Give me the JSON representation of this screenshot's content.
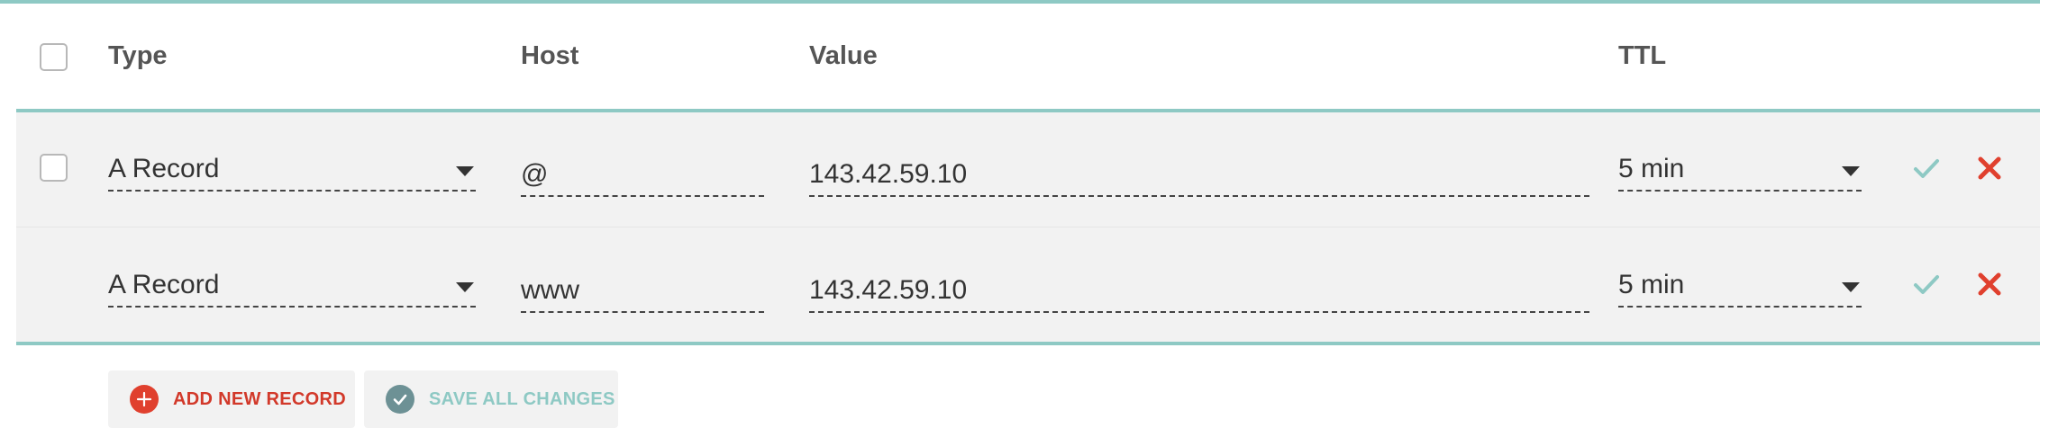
{
  "header": {
    "type_label": "Type",
    "host_label": "Host",
    "value_label": "Value",
    "ttl_label": "TTL"
  },
  "records": [
    {
      "type": "A Record",
      "host": "@",
      "value": "143.42.59.10",
      "ttl": "5 min",
      "has_checkbox": true
    },
    {
      "type": "A Record",
      "host": "www",
      "value": "143.42.59.10",
      "ttl": "5 min",
      "has_checkbox": false
    }
  ],
  "actions": {
    "add_label": "ADD NEW RECORD",
    "save_label": "SAVE ALL CHANGES"
  },
  "colors": {
    "accent_teal": "#8ec9c4",
    "delete_red": "#e0402e",
    "save_icon": "#6d9195",
    "row_bg": "#f2f2f2"
  },
  "icons": {
    "select_all": "checkbox-icon",
    "dropdown": "caret-down-icon",
    "confirm": "check-icon",
    "delete": "close-icon",
    "add": "plus-circle-icon",
    "save": "check-circle-icon"
  }
}
